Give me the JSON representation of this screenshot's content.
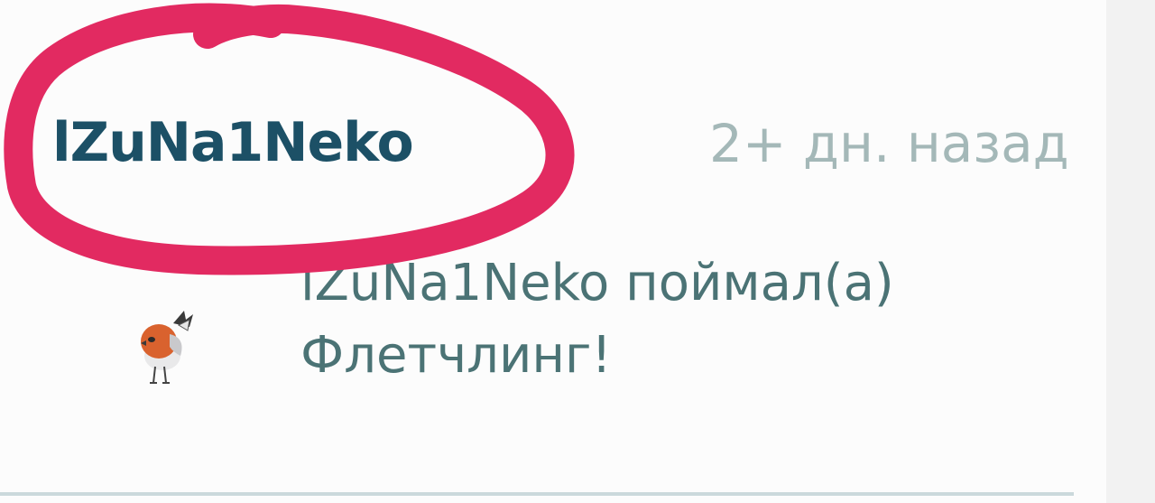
{
  "activity": {
    "username": "lZuNa1Neko",
    "time_ago": "2+ дн. назад",
    "message_line1": "lZuNa1Neko поймал(а)",
    "message_line2": "Флетчлинг!",
    "pokemon_icon": "fletchling-icon"
  },
  "annotation": {
    "shape": "freehand-circle",
    "color": "#e22a61"
  },
  "colors": {
    "username": "#1c5066",
    "time": "#a4b8b8",
    "message": "#4b7375",
    "divider": "#cbd9dc"
  }
}
